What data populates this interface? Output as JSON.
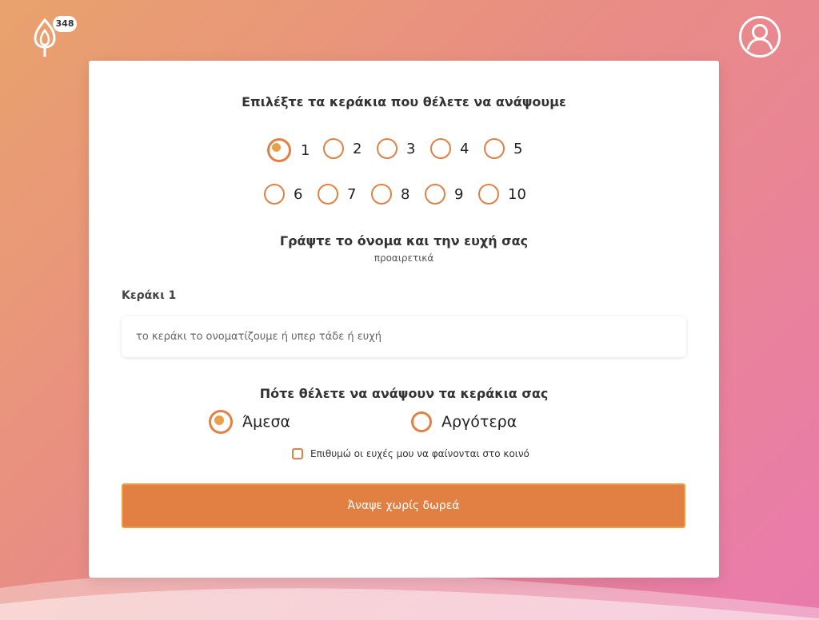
{
  "header": {
    "candle_count": "348",
    "logo_icon": "candle-flame-icon",
    "account_icon": "user-circle-icon"
  },
  "form": {
    "candles_heading": "Επιλέξτε τα κεράκια που θέλετε να ανάψουμε",
    "candle_options": [
      "1",
      "2",
      "3",
      "4",
      "5",
      "6",
      "7",
      "8",
      "9",
      "10"
    ],
    "selected_candles": "1",
    "name_heading": "Γράψτε το όνομα και την ευχή σας",
    "name_subheading": "προαιρετικά",
    "candle_field_label": "Κεράκι 1",
    "candle_field_placeholder": "το κεράκι το ονοματίζουμε ή υπερ τάδε ή ευχή",
    "candle_field_value": "",
    "timing_heading": "Πότε θέλετε να ανάψουν τα κεράκια σας",
    "timing_options": [
      "Άμεσα",
      "Αργότερα"
    ],
    "selected_timing": "Άμεσα",
    "public_wishes_label": "Επιθυμώ οι ευχές μου να φαίνονται στο κοινό",
    "public_wishes_checked": false,
    "submit_label": "Άναψε χωρίς δωρεά"
  },
  "colors": {
    "accent": "#e28044",
    "radio_fill": "#e9a04a",
    "background_start": "#e9a26c",
    "background_end": "#e97aad"
  }
}
